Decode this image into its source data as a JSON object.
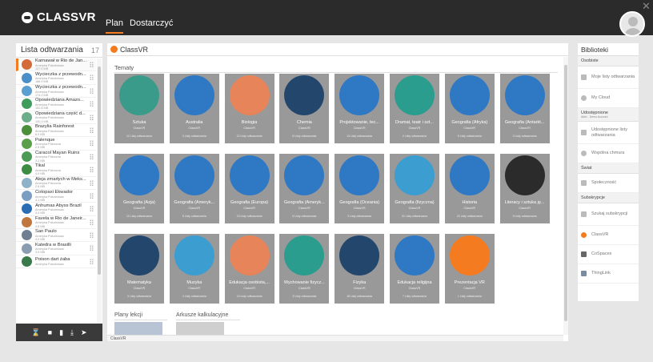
{
  "topbar": {
    "brand": "CLASSVR",
    "nav": [
      "Plan",
      "Dostarczyć"
    ],
    "active_nav": "Plan"
  },
  "playlist": {
    "title": "Lista odtwarzania",
    "count": "17",
    "items": [
      {
        "title": "Karnawał w Rio de Jan...",
        "sub1": "Ameryka Południowa",
        "sub2": "137.5 MB",
        "color": "#d46a3a"
      },
      {
        "title": "Wycieczka z przewodn...",
        "sub1": "Ameryka Południowa",
        "sub2": "188.9 MB",
        "color": "#4a8fc9"
      },
      {
        "title": "Wycieczka z przewodn...",
        "sub1": "Ameryka Południowa",
        "sub2": "174.0 MB",
        "color": "#5a9fd0"
      },
      {
        "title": "Opowiedziana Amazo...",
        "sub1": "Ameryka Południowa",
        "sub2": "152.8 MB",
        "color": "#3f9d5c"
      },
      {
        "title": "Opowiedziana część d...",
        "sub1": "Ameryka Południowa",
        "sub2": "140.3 MB",
        "color": "#6cae8a"
      },
      {
        "title": "Brazylia Rainforest",
        "sub1": "Ameryka Południowa",
        "sub2": "6.0 MB",
        "color": "#4c8f3a"
      },
      {
        "title": "Palenque",
        "sub1": "Ameryka Północna",
        "sub2": "2.6 MB",
        "color": "#5aa04a"
      },
      {
        "title": "Caracol Mayan Ruins",
        "sub1": "Ameryka Północna",
        "sub2": "3.2 MB",
        "color": "#4b9a56"
      },
      {
        "title": "Tikal",
        "sub1": "Ameryka Północna",
        "sub2": "4.9 MB",
        "color": "#3c8c44"
      },
      {
        "title": "Aleja zmarłych w Meks...",
        "sub1": "Ameryka Północna",
        "sub2": "2.6 MB",
        "color": "#8fb2c9"
      },
      {
        "title": "Cotopaxi Ekwador",
        "sub1": "Ameryka Południowa",
        "sub2": "4.1 MB",
        "color": "#7a9dc2"
      },
      {
        "title": "Anhumas Abyss Brazil",
        "sub1": "Ameryka Południowa",
        "sub2": "3.4 MB",
        "color": "#2a6db5"
      },
      {
        "title": "Favela w Rio de Janeir...",
        "sub1": "Ameryka Południowa",
        "sub2": "4.8 MB",
        "color": "#c0763c"
      },
      {
        "title": "San Paulo",
        "sub1": "Ameryka Południowa",
        "sub2": "4.0 MB",
        "color": "#6f7f91"
      },
      {
        "title": "Katedra w Brasilli",
        "sub1": "Ameryka Południowa",
        "sub2": "3.5 MB",
        "color": "#8a9db0"
      },
      {
        "title": "Poison dart żaba",
        "sub1": "Ameryka Południowa",
        "sub2": "",
        "color": "#3a7a4a"
      }
    ],
    "footer_icons": [
      "hourglass-icon",
      "save-icon",
      "trash-icon",
      "download-icon",
      "send-icon"
    ]
  },
  "main": {
    "title": "ClassVR",
    "section": "Tematy",
    "tiles": [
      {
        "name": "Sztuka",
        "brand": "ClassVR",
        "count": "12 Listy odtwarzania",
        "bg": "#3a9b8a"
      },
      {
        "name": "Australia",
        "brand": "ClassVR",
        "count": "3 Listy odtwarzania",
        "bg": "#2e78c4"
      },
      {
        "name": "Biologia",
        "brand": "ClassVR",
        "count": "22 Listy odtwarzania",
        "bg": "#e8845a"
      },
      {
        "name": "Chemia",
        "brand": "ClassVR",
        "count": "5 Listy odtwarzania",
        "bg": "#23466d"
      },
      {
        "name": "Projektowanie, tec...",
        "brand": "ClassVR",
        "count": "13 Listy odtwarzania",
        "bg": "#2e78c4"
      },
      {
        "name": "Dramat, teatr i szt...",
        "brand": "ClassVR",
        "count": "2 Listy odtwarzania",
        "bg": "#2a9d8f"
      },
      {
        "name": "Geografia (Afryka)",
        "brand": "ClassVR",
        "count": "5 Listy odtwarzania",
        "bg": "#2e78c4"
      },
      {
        "name": "Geografia (Antarkt...",
        "brand": "ClassVR",
        "count": "2 Listy odtwarzania",
        "bg": "#2e78c4"
      },
      {
        "name": "Geografia (Azja)",
        "brand": "ClassVR",
        "count": "10 Listy odtwarzania",
        "bg": "#2e78c4"
      },
      {
        "name": "Geografia (Ameryk...",
        "brand": "ClassVR",
        "count": "5 Listy odtwarzania",
        "bg": "#2e78c4"
      },
      {
        "name": "Geografia (Europa)",
        "brand": "ClassVR",
        "count": "23 Listy odtwarzania",
        "bg": "#2e78c4"
      },
      {
        "name": "Geografia (Ameryk...",
        "brand": "ClassVR",
        "count": "5 Listy odtwarzania",
        "bg": "#2e78c4"
      },
      {
        "name": "Geografia (Oceania)",
        "brand": "ClassVR",
        "count": "3 Listy odtwarzania",
        "bg": "#2e78c4"
      },
      {
        "name": "Geografia (fizyczna)",
        "brand": "ClassVR",
        "count": "31 Listy odtwarzania",
        "bg": "#3c9dd0"
      },
      {
        "name": "Historia",
        "brand": "ClassVR",
        "count": "23 Listy odtwarzania",
        "bg": "#2e78c4"
      },
      {
        "name": "Literacy i sztuka ję...",
        "brand": "ClassVR",
        "count": "9 Listy odtwarzania",
        "bg": "#2b2b2b"
      },
      {
        "name": "Matematyka",
        "brand": "ClassVR",
        "count": "3 Listy odtwarzania",
        "bg": "#23466d"
      },
      {
        "name": "Muzyka",
        "brand": "ClassVR",
        "count": "4 Listy odtwarzania",
        "bg": "#3c9dd0"
      },
      {
        "name": "Edukacja osobista,...",
        "brand": "ClassVR",
        "count": "15 Listy odtwarzania",
        "bg": "#e8845a"
      },
      {
        "name": "Wychowanie fizycz...",
        "brand": "ClassVR",
        "count": "3 Listy odtwarzania",
        "bg": "#2a9d8f"
      },
      {
        "name": "Fizyka",
        "brand": "ClassVR",
        "count": "18 Listy odtwarzania",
        "bg": "#23466d"
      },
      {
        "name": "Edukacja religijna",
        "brand": "ClassVR",
        "count": "7 Listy odtwarzania",
        "bg": "#2e78c4"
      },
      {
        "name": "Prezentacja VR",
        "brand": "ClassVR",
        "count": "1 Listy odtwarzania",
        "bg": "#f47b20"
      }
    ],
    "bottom_sections": [
      "Plany lekcji",
      "Arkusze kalkulacyjne"
    ],
    "footer": "ClassVR"
  },
  "libraries": {
    "title": "Biblioteki",
    "sections": [
      {
        "label": "Osobiste",
        "sub": "",
        "items": [
          {
            "label": "Moje listy odtwarzania",
            "icon": "playlist-icon"
          },
          {
            "label": "My Cloud",
            "icon": "cloud-icon"
          }
        ]
      },
      {
        "label": "Udostępnione",
        "sub": "Aktiv - Demo Account",
        "items": [
          {
            "label": "Udostępnione listy odtwarzania",
            "icon": "shared-playlist-icon"
          },
          {
            "label": "Wspólna chmura",
            "icon": "shared-cloud-icon"
          }
        ]
      },
      {
        "label": "Świat",
        "sub": "",
        "items": [
          {
            "label": "Społeczność",
            "icon": "community-icon"
          }
        ]
      },
      {
        "label": "Subskrypcje",
        "sub": "",
        "items": [
          {
            "label": "Szukaj subskrypcji",
            "icon": "search-icon"
          },
          {
            "label": "ClassVR",
            "icon": "classvr-icon"
          },
          {
            "label": "CoSpaces",
            "icon": "cospaces-icon"
          },
          {
            "label": "ThingLink",
            "icon": "thinglink-icon"
          }
        ]
      }
    ]
  }
}
